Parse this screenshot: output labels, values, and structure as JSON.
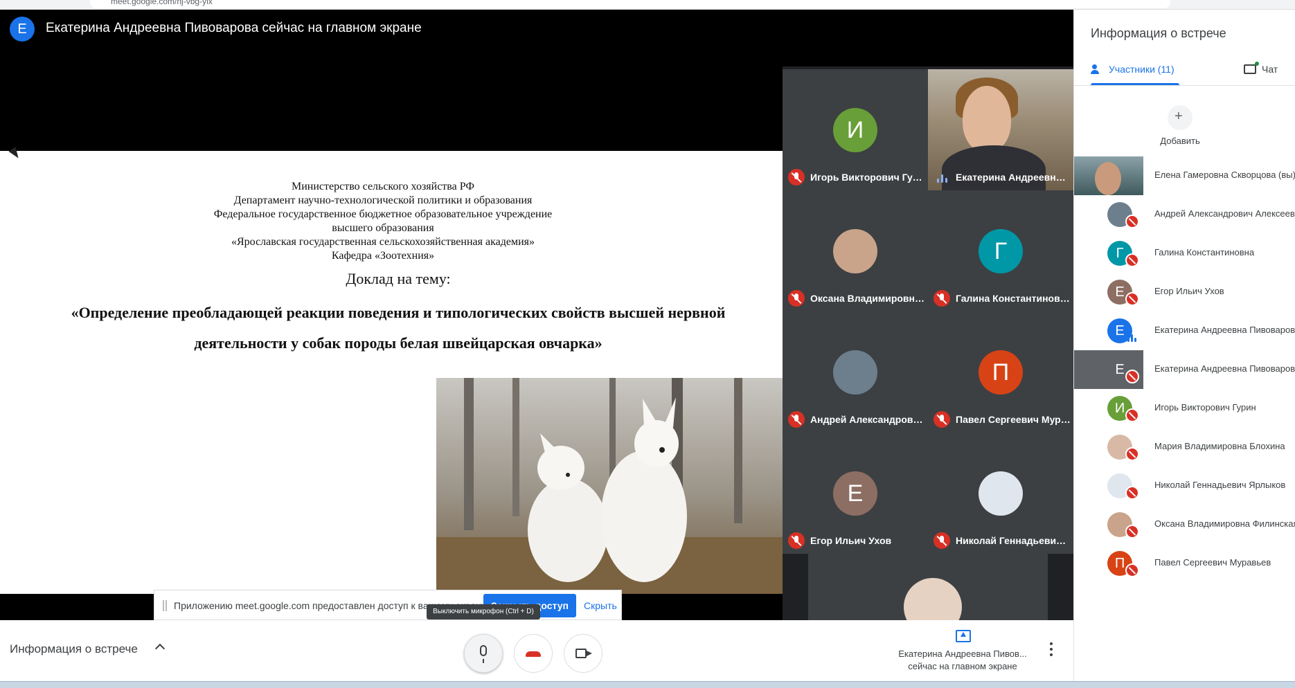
{
  "browser": {
    "url": "meet.google.com/nj-vbg-yix"
  },
  "stage": {
    "presenter_initial": "Е",
    "presenter_title": "Екатерина Андреевна Пивоварова сейчас на главном экране"
  },
  "slide": {
    "header_lines": [
      "Министерство сельского хозяйства РФ",
      "Департамент научно-технологической политики и образования",
      "Федеральное государственное бюджетное образовательное учреждение",
      "высшего образования",
      "«Ярославская государственная сельскохозяйственная академия»",
      "Кафедра «Зоотехния»"
    ],
    "topic": "Доклад на тему:",
    "subject": "«Определение преобладающей реакции поведения и типологических свойств высшей нервной деятельности у собак породы белая швейцарская овчарка»"
  },
  "share_toast": {
    "message": "Приложению meet.google.com предоставлен доступ к вашему экрану.",
    "stop_button": "Закрыть доступ",
    "hide_link": "Скрыть"
  },
  "tiles": [
    {
      "name": "Игорь Викторович Гурин",
      "initial": "И",
      "color": "#689f38",
      "mic": "muted"
    },
    {
      "name": "Екатерина Андреевна Пивоварова",
      "initial": "",
      "color": "#7d6f5c",
      "mic": "speaking",
      "video": true
    },
    {
      "name": "Оксана Владимировна Филинская",
      "initial": "",
      "color": "#c9a48a",
      "mic": "muted"
    },
    {
      "name": "Галина Константиновна",
      "initial": "Г",
      "color": "#0097a7",
      "mic": "muted"
    },
    {
      "name": "Андрей Александрович Алексеев",
      "initial": "",
      "color": "#6d7f8c",
      "mic": "muted"
    },
    {
      "name": "Павел Сергеевич Муравьев",
      "initial": "П",
      "color": "#d84315",
      "mic": "muted"
    },
    {
      "name": "Егор Ильич Ухов",
      "initial": "Е",
      "color": "#8d6e63",
      "mic": "muted"
    },
    {
      "name": "Николай Геннадьевич Ярлыков",
      "initial": "",
      "color": "#dfe6ee",
      "mic": "muted"
    }
  ],
  "toolbar": {
    "meeting_info": "Информация о встрече",
    "mic_tooltip": "Выключить микрофон (Ctrl + D)",
    "presenting_line1": "Екатерина Андреевна Пивов...",
    "presenting_line2": "сейчас на главном экране"
  },
  "panel": {
    "title": "Информация о встрече",
    "tab_participants": "Участники (11)",
    "tab_chat": "Чат",
    "add_label": "Добавить",
    "participants": [
      {
        "name": "Елена Гамеровна Скворцова (вы)",
        "initial": "",
        "color": "#3f5a5d",
        "mic": "dots",
        "variant": "self"
      },
      {
        "name": "Андрей Александрович Алексеев",
        "initial": "",
        "color": "#6d7f8c",
        "mic": "muted"
      },
      {
        "name": "Галина Константиновна",
        "initial": "Г",
        "color": "#0097a7",
        "mic": "muted"
      },
      {
        "name": "Егор Ильич Ухов",
        "initial": "Е",
        "color": "#8d6e63",
        "mic": "muted"
      },
      {
        "name": "Екатерина Андреевна Пивоварова",
        "initial": "Е",
        "color": "#1a73e8",
        "mic": "speaking"
      },
      {
        "name": "Екатерина Андреевна Пивоварова",
        "initial": "Е",
        "color": "#5f6368",
        "mic": "muted",
        "variant": "dim"
      },
      {
        "name": "Игорь Викторович Гурин",
        "initial": "И",
        "color": "#689f38",
        "mic": "muted"
      },
      {
        "name": "Мария Владимировна Блохина",
        "initial": "",
        "color": "#d7b9a5",
        "mic": "muted"
      },
      {
        "name": "Николай Геннадьевич Ярлыков",
        "initial": "",
        "color": "#dfe6ee",
        "mic": "muted"
      },
      {
        "name": "Оксана Владимировна Филинская",
        "initial": "",
        "color": "#c9a48a",
        "mic": "muted"
      },
      {
        "name": "Павел Сергеевич Муравьев",
        "initial": "П",
        "color": "#d84315",
        "mic": "muted"
      }
    ]
  }
}
